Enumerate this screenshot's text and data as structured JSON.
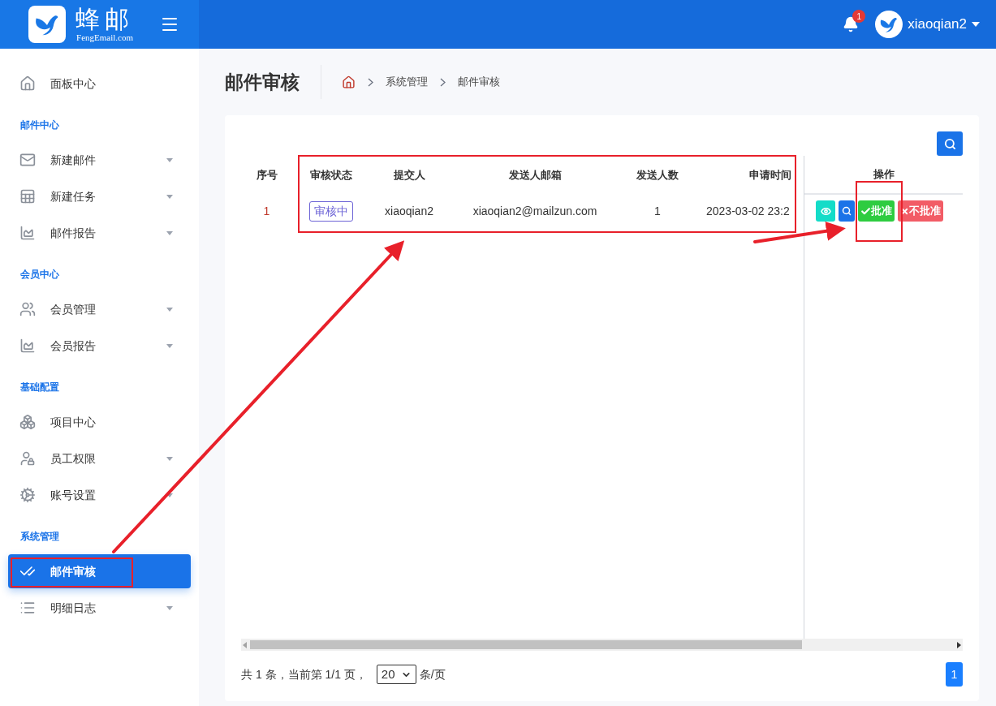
{
  "header": {
    "logo_title": "蜂邮",
    "logo_subtitle": "FengEmail.com",
    "notification_count": "1",
    "username": "xiaoqian2"
  },
  "sidebar": {
    "items": [
      {
        "kind": "item",
        "label": "面板中心",
        "caret": false,
        "selected": false
      },
      {
        "kind": "section",
        "label": "邮件中心"
      },
      {
        "kind": "item",
        "label": "新建邮件",
        "caret": true,
        "selected": false
      },
      {
        "kind": "item",
        "label": "新建任务",
        "caret": true,
        "selected": false
      },
      {
        "kind": "item",
        "label": "邮件报告",
        "caret": true,
        "selected": false
      },
      {
        "kind": "section",
        "label": "会员中心"
      },
      {
        "kind": "item",
        "label": "会员管理",
        "caret": true,
        "selected": false
      },
      {
        "kind": "item",
        "label": "会员报告",
        "caret": true,
        "selected": false
      },
      {
        "kind": "section",
        "label": "基础配置"
      },
      {
        "kind": "item",
        "label": "项目中心",
        "caret": false,
        "selected": false
      },
      {
        "kind": "item",
        "label": "员工权限",
        "caret": true,
        "selected": false
      },
      {
        "kind": "item",
        "label": "账号设置",
        "caret": true,
        "selected": false
      },
      {
        "kind": "section",
        "label": "系统管理"
      },
      {
        "kind": "item",
        "label": "邮件审核",
        "caret": false,
        "selected": true
      },
      {
        "kind": "item",
        "label": "明细日志",
        "caret": true,
        "selected": false
      }
    ]
  },
  "page_title": "邮件审核",
  "breadcrumb": [
    "系统管理",
    "邮件审核"
  ],
  "table": {
    "columns": [
      "序号",
      "审核状态",
      "提交人",
      "发送人邮箱",
      "发送人数",
      "申请时间"
    ],
    "action_column": "操作",
    "rows": [
      {
        "index": "1",
        "status": "审核中",
        "submitter": "xiaoqian2",
        "email": "xiaoqian2@mailzun.com",
        "count": "1",
        "time": "2023-03-02 23:2",
        "actions": [
          {
            "kind": "view"
          },
          {
            "kind": "search"
          },
          {
            "kind": "approve",
            "label": "批准"
          },
          {
            "kind": "reject",
            "label": "不批准"
          }
        ]
      }
    ]
  },
  "pagination": {
    "summary": "共 1 条，当前第 1/1 页，",
    "page_size": "20",
    "page_size_unit": "条/页",
    "pages": [
      {
        "label": "1",
        "selected": true
      }
    ]
  }
}
